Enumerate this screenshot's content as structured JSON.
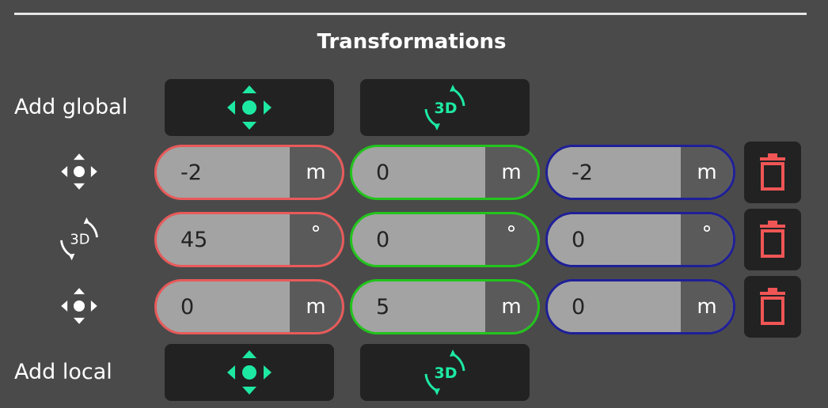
{
  "title": "Transformations",
  "add_global": {
    "label": "Add global",
    "translate_icon": "move-arrows-icon",
    "rotate_icon": "rotate-3d-icon",
    "rotate_text": "3D"
  },
  "transforms": [
    {
      "type": "translate",
      "icon": "move-arrows-icon",
      "x": {
        "value": "-2",
        "unit": "m"
      },
      "y": {
        "value": "0",
        "unit": "m"
      },
      "z": {
        "value": "-2",
        "unit": "m"
      }
    },
    {
      "type": "rotate",
      "icon": "rotate-3d-icon",
      "icon_text": "3D",
      "x": {
        "value": "45",
        "unit": "°"
      },
      "y": {
        "value": "0",
        "unit": "°"
      },
      "z": {
        "value": "0",
        "unit": "°"
      }
    },
    {
      "type": "translate",
      "icon": "move-arrows-icon",
      "x": {
        "value": "0",
        "unit": "m"
      },
      "y": {
        "value": "5",
        "unit": "m"
      },
      "z": {
        "value": "0",
        "unit": "m"
      }
    }
  ],
  "add_local": {
    "label": "Add local",
    "translate_icon": "move-arrows-icon",
    "rotate_icon": "rotate-3d-icon",
    "rotate_text": "3D"
  },
  "colors": {
    "background": "#4a4a4a",
    "button_bg": "#222222",
    "accent": "#1de9a3",
    "x_axis": "#e85a5a",
    "y_axis": "#22c41c",
    "z_axis": "#1f1f99",
    "delete": "#f05555"
  }
}
